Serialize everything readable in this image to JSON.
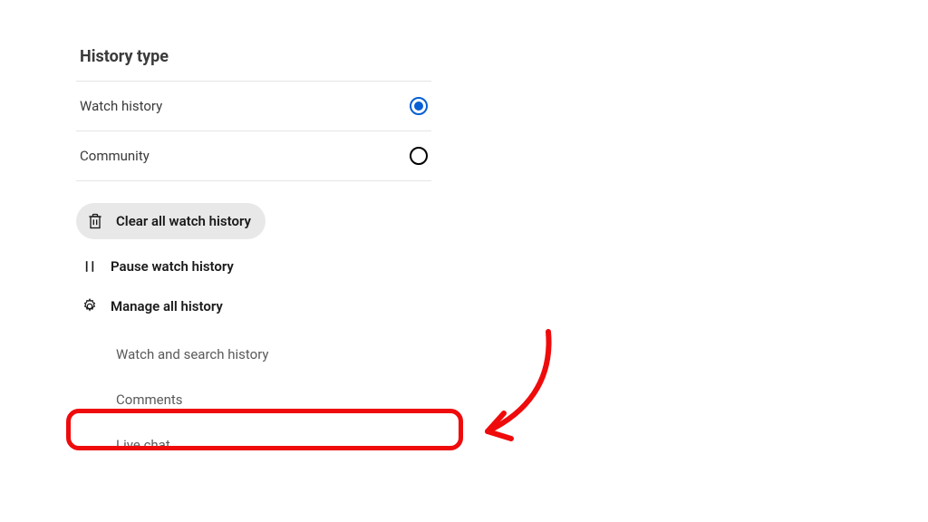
{
  "section_title": "History type",
  "radios": {
    "watch_history": {
      "label": "Watch history",
      "selected": true
    },
    "community": {
      "label": "Community",
      "selected": false
    }
  },
  "actions": {
    "clear_all": "Clear all watch history",
    "pause": "Pause watch history",
    "manage": "Manage all history"
  },
  "sub_items": {
    "watch_search": "Watch and search history",
    "comments": "Comments",
    "live_chat": "Live chat"
  },
  "annotation": {
    "highlight_target": "comments",
    "color": "#ef0b0b"
  }
}
